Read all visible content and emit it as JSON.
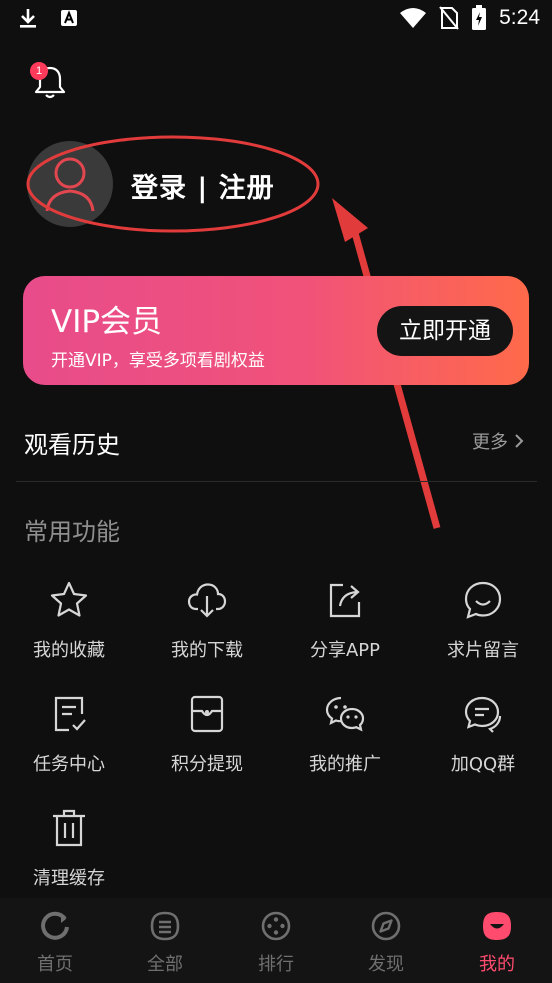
{
  "status_bar": {
    "time": "5:24"
  },
  "notifications": {
    "badge_count": "1"
  },
  "profile": {
    "login_label": "登录 | 注册"
  },
  "vip": {
    "title": "VIP会员",
    "subtitle": "开通VIP，享受多项看剧权益",
    "button_label": "立即开通",
    "gradient_start": "#e84c8a",
    "gradient_end": "#ff6a4a"
  },
  "history": {
    "title": "观看历史",
    "more_label": "更多"
  },
  "functions": {
    "title": "常用功能",
    "items": [
      {
        "label": "我的收藏",
        "icon": "star-icon"
      },
      {
        "label": "我的下载",
        "icon": "cloud-download-icon"
      },
      {
        "label": "分享APP",
        "icon": "share-icon"
      },
      {
        "label": "求片留言",
        "icon": "chat-smile-icon"
      },
      {
        "label": "任务中心",
        "icon": "task-icon"
      },
      {
        "label": "积分提现",
        "icon": "wallet-icon"
      },
      {
        "label": "我的推广",
        "icon": "wechat-icon"
      },
      {
        "label": "加QQ群",
        "icon": "group-chat-icon"
      },
      {
        "label": "清理缓存",
        "icon": "trash-icon"
      }
    ]
  },
  "bottom_nav": {
    "items": [
      {
        "label": "首页",
        "icon": "home-icon"
      },
      {
        "label": "全部",
        "icon": "all-icon"
      },
      {
        "label": "排行",
        "icon": "ranking-icon"
      },
      {
        "label": "发现",
        "icon": "compass-icon"
      },
      {
        "label": "我的",
        "icon": "profile-icon",
        "active": true
      }
    ],
    "active_color": "#ff4b6e"
  }
}
